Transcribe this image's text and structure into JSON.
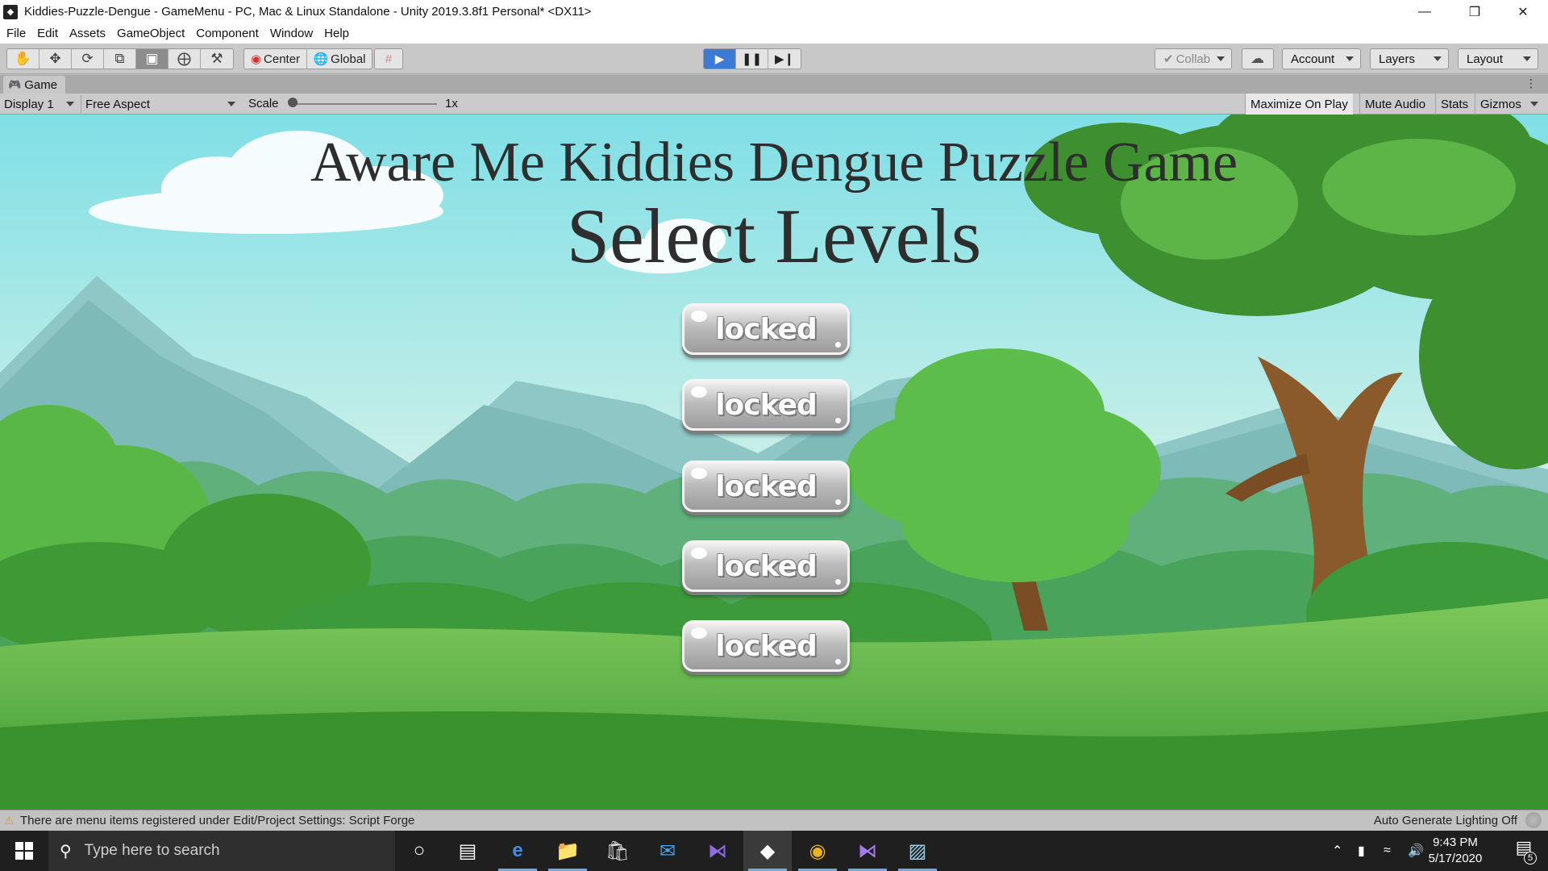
{
  "window": {
    "title": "Kiddies-Puzzle-Dengue - GameMenu - PC, Mac & Linux Standalone - Unity 2019.3.8f1 Personal* <DX11>",
    "minimize": "—",
    "restore": "❒",
    "close": "✕"
  },
  "menu": {
    "items": [
      "File",
      "Edit",
      "Assets",
      "GameObject",
      "Component",
      "Window",
      "Help"
    ]
  },
  "toolbar": {
    "tools": [
      "hand-tool",
      "move-tool",
      "rotate-tool",
      "scale-tool",
      "rect-tool",
      "transform-tool",
      "custom-tool"
    ],
    "active_tool": "rect-tool",
    "pivot_mode": "Center",
    "pivot_rotation": "Global",
    "collab": "Collab",
    "account": "Account",
    "layers": "Layers",
    "layout": "Layout",
    "play_active": true
  },
  "game_tab": {
    "label": "Game",
    "display": "Display 1",
    "aspect": "Free Aspect",
    "scale_label": "Scale",
    "scale_value": "1x",
    "maximize_on_play": "Maximize On Play",
    "mute_audio": "Mute Audio",
    "stats": "Stats",
    "gizmos": "Gizmos"
  },
  "game": {
    "title": "Aware Me Kiddies Dengue Puzzle Game",
    "subtitle": "Select Levels",
    "levels": [
      {
        "label": "locked"
      },
      {
        "label": "locked"
      },
      {
        "label": "locked"
      },
      {
        "label": "locked"
      },
      {
        "label": "locked"
      }
    ]
  },
  "status": {
    "message": "There are menu items registered under Edit/Project Settings: Script Forge",
    "lighting": "Auto Generate Lighting Off"
  },
  "taskbar": {
    "search_placeholder": "Type here to search",
    "time": "9:43 PM",
    "date": "5/17/2020",
    "notification_count": "5",
    "accent": "#76a8e8"
  }
}
